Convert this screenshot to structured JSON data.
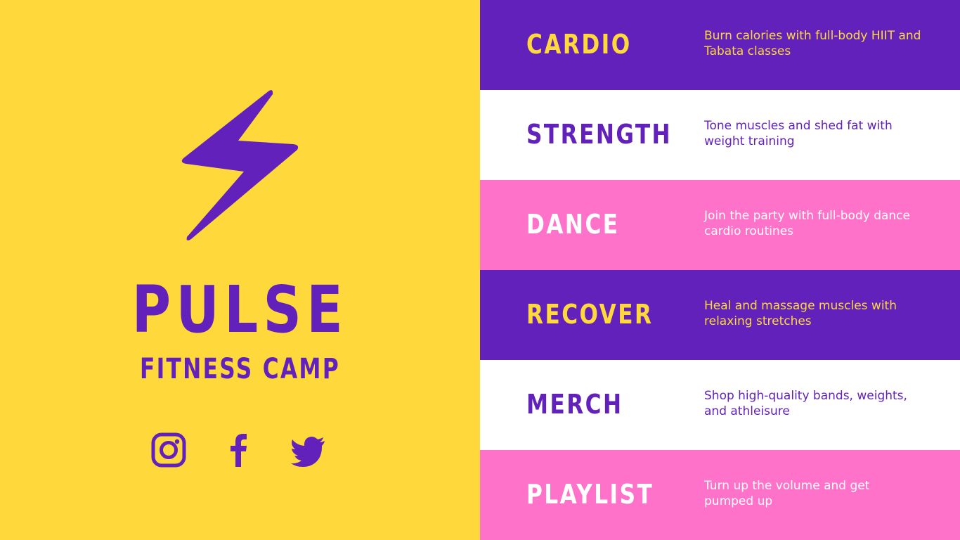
{
  "colors": {
    "yellow": "#FFD93B",
    "purple": "#6221BB",
    "white": "#FFFFFF",
    "pink": "#FF72C9"
  },
  "brand": {
    "title": "PULSE",
    "subtitle": "FITNESS CAMP",
    "logo_icon": "lightning-bolt-icon"
  },
  "social": [
    {
      "icon": "instagram-icon"
    },
    {
      "icon": "facebook-icon"
    },
    {
      "icon": "twitter-icon"
    }
  ],
  "programs": [
    {
      "title": "CARDIO",
      "description": "Burn calories with full-body HIIT and Tabata classes",
      "bg": "#6221BB",
      "title_color": "#FFD93B",
      "desc_color": "#FFD93B"
    },
    {
      "title": "STRENGTH",
      "description": "Tone muscles and shed fat with weight training",
      "bg": "#FFFFFF",
      "title_color": "#6221BB",
      "desc_color": "#6221BB"
    },
    {
      "title": "DANCE",
      "description": "Join the party with full-body dance cardio routines",
      "bg": "#FF72C9",
      "title_color": "#FFFFFF",
      "desc_color": "#FFFFFF"
    },
    {
      "title": "RECOVER",
      "description": "Heal and massage muscles with relaxing stretches",
      "bg": "#6221BB",
      "title_color": "#FFD93B",
      "desc_color": "#FFD93B"
    },
    {
      "title": "MERCH",
      "description": "Shop high-quality bands, weights, and athleisure",
      "bg": "#FFFFFF",
      "title_color": "#6221BB",
      "desc_color": "#6221BB"
    },
    {
      "title": "PLAYLIST",
      "description": "Turn up the volume and get pumped up",
      "bg": "#FF72C9",
      "title_color": "#FFFFFF",
      "desc_color": "#FFFFFF"
    }
  ]
}
